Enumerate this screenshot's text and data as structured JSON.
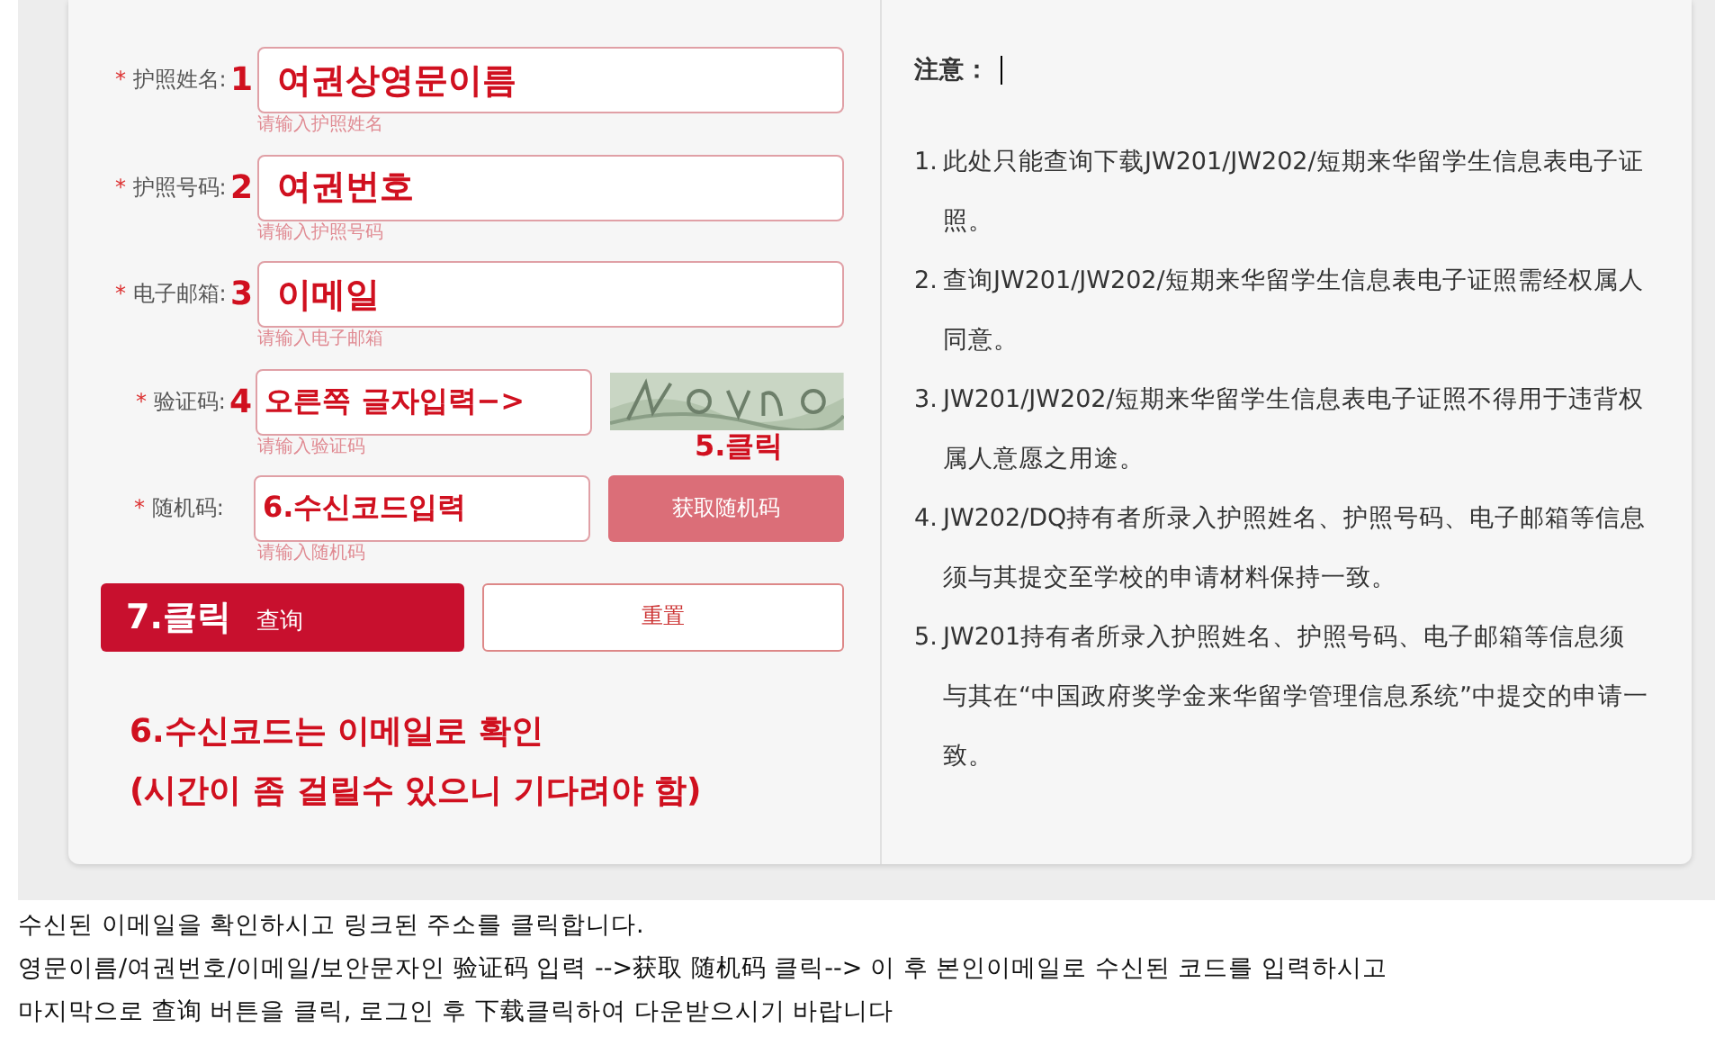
{
  "fields": [
    {
      "required_mark": "*",
      "label": "护照姓名:",
      "marker": "1",
      "value": "여권상영문이름",
      "hint": "请输入护照姓名",
      "kind": "text"
    },
    {
      "required_mark": "*",
      "label": "护照号码:",
      "marker": "2",
      "value": "여권번호",
      "hint": "请输入护照号码",
      "kind": "text"
    },
    {
      "required_mark": "*",
      "label": "电子邮箱:",
      "marker": "3",
      "value": "이메일",
      "hint": "请输入电子邮箱",
      "kind": "text"
    },
    {
      "required_mark": "*",
      "label": "验证码:",
      "marker": "4",
      "value": "오른쪽 글자입력−>",
      "hint": "请输入验证码",
      "kind": "captcha"
    },
    {
      "required_mark": "*",
      "label": "随机码:",
      "value": "6.수신코드입력",
      "hint": "请输入随机码",
      "kind": "code"
    }
  ],
  "captcha": {
    "kind": "picture"
  },
  "code_button": {
    "note": "5.클릭",
    "label": "获取随机码"
  },
  "submit_button": {
    "note": "7.클릭",
    "label": "查询"
  },
  "reset_button": {
    "label": "重置"
  },
  "annotations": [
    "6.수신코드는 이메일로 확인",
    "(시간이 좀 걸릴수 있으니 기다려야 함)"
  ],
  "notice": {
    "title": "注意：",
    "items": [
      {
        "number": "1.",
        "text": "此处只能查询下载JW201/JW202/短期来华留学生信息表电子证照。"
      },
      {
        "number": "2.",
        "text": "查询JW201/JW202/短期来华留学生信息表电子证照需经权属人同意。"
      },
      {
        "number": "3.",
        "text": "JW201/JW202/短期来华留学生信息表电子证照不得用于违背权属人意愿之用途。"
      },
      {
        "number": "4.",
        "text": "JW202/DQ持有者所录入护照姓名、护照号码、电子邮箱等信息须与其提交至学校的申请材料保持一致。"
      },
      {
        "number": "5.",
        "text": "JW201持有者所录入护照姓名、护照号码、电子邮箱等信息须与其在“中国政府奖学金来华留学管理信息系统”中提交的申请一致。"
      }
    ]
  },
  "caption_lines": [
    "수신된 이메일을 확인하시고 링크된 주소를 클릭합니다.",
    "영문이름/여권번호/이메일/보안문자인 验证码 입력 -->获取 随机码 클릭--> 이 후 본인이메일로 수신된 코드를 입력하시고",
    "마지막으로 查询 버튼을 클릭, 로그인 후 下载클릭하여 다운받으시기 바랍니다"
  ]
}
